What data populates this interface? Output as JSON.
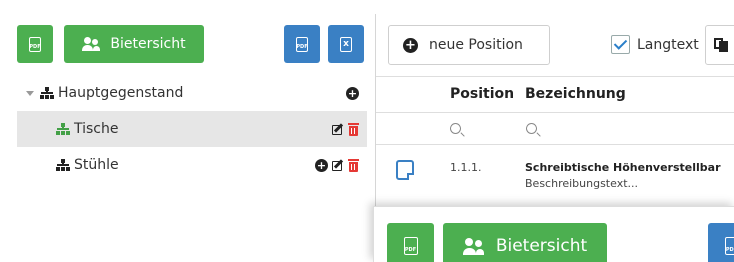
{
  "toolbar": {
    "pdf_icon_label": "PDF",
    "bietersicht_label": "Bietersicht",
    "excel_icon_label": "x"
  },
  "tree": {
    "root": {
      "label": "Hauptgegenstand"
    },
    "children": [
      {
        "label": "Tische"
      },
      {
        "label": "Stühle"
      }
    ]
  },
  "right_toolbar": {
    "new_position_label": "neue Position",
    "langtext_label": "Langtext",
    "langtext_checked": true
  },
  "table": {
    "columns": [
      "Position",
      "Bezeichnung"
    ],
    "rows": [
      {
        "position": "1.1.1.",
        "title": "Schreibtische Höhenverstellbar",
        "description": "Beschreibungstext..."
      }
    ]
  },
  "overlay": {
    "pdf_icon_label": "PDF",
    "bietersicht_label": "Bietersicht"
  },
  "colors": {
    "green": "#4caf50",
    "blue": "#3a80c4",
    "red": "#e53935",
    "selected_row": "#e6e6e6"
  }
}
